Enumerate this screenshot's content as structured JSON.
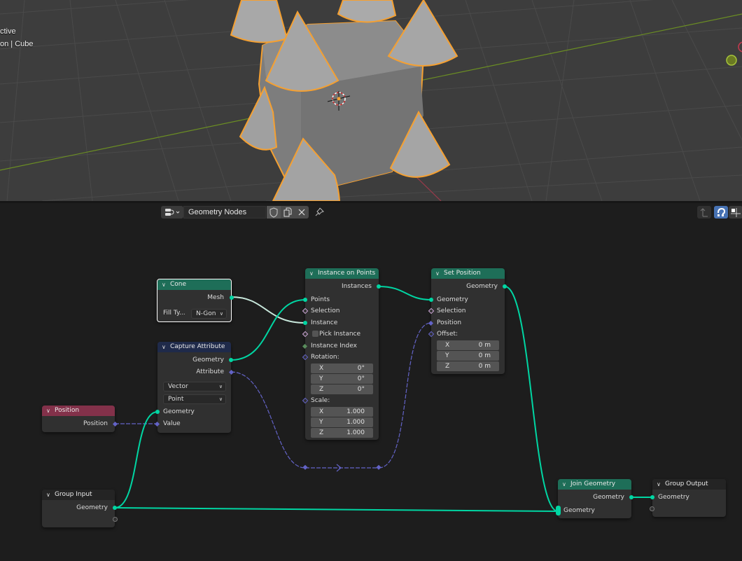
{
  "viewport": {
    "overlay_line1": "ctive",
    "overlay_line2": "on | Cube"
  },
  "header": {
    "editor_type_icon": "node-editor-icon",
    "node_tree_name": "Geometry Nodes",
    "fake_user_icon": "shield-icon",
    "duplicate_icon": "duplicate-icon",
    "unlink_icon": "close-icon",
    "pin_icon": "pin-icon",
    "parent_icon": "parent-arrow-icon",
    "snap_icon": "snap-magnet-icon",
    "grid_icon": "grid-icon"
  },
  "nodes": {
    "cone": {
      "title": "Cone",
      "outputs": [
        "Mesh"
      ],
      "fill_type_label": "Fill Ty...",
      "fill_type_value": "N-Gon"
    },
    "capture_attribute": {
      "title": "Capture Attribute",
      "outputs": [
        "Geometry",
        "Attribute"
      ],
      "data_type": "Vector",
      "domain": "Point",
      "inputs": [
        "Geometry",
        "Value"
      ]
    },
    "position": {
      "title": "Position",
      "outputs": [
        "Position"
      ]
    },
    "group_input": {
      "title": "Group Input",
      "outputs": [
        "Geometry"
      ]
    },
    "instance_on_points": {
      "title": "Instance on Points",
      "outputs": [
        "Instances"
      ],
      "inputs": [
        "Points",
        "Selection",
        "Instance",
        "Pick Instance",
        "Instance Index",
        "Rotation:",
        "Scale:"
      ],
      "rotation": [
        {
          "axis": "X",
          "value": "0°"
        },
        {
          "axis": "Y",
          "value": "0°"
        },
        {
          "axis": "Z",
          "value": "0°"
        }
      ],
      "scale": [
        {
          "axis": "X",
          "value": "1.000"
        },
        {
          "axis": "Y",
          "value": "1.000"
        },
        {
          "axis": "Z",
          "value": "1.000"
        }
      ],
      "pick_instance": false
    },
    "set_position": {
      "title": "Set Position",
      "outputs": [
        "Geometry"
      ],
      "inputs": [
        "Geometry",
        "Selection",
        "Position",
        "Offset:"
      ],
      "offset": [
        {
          "axis": "X",
          "value": "0 m"
        },
        {
          "axis": "Y",
          "value": "0 m"
        },
        {
          "axis": "Z",
          "value": "0 m"
        }
      ]
    },
    "join_geometry": {
      "title": "Join Geometry",
      "outputs": [
        "Geometry"
      ],
      "inputs": [
        "Geometry"
      ]
    },
    "group_output": {
      "title": "Group Output",
      "inputs": [
        "Geometry"
      ]
    }
  },
  "colors": {
    "geometry_socket": "#00d6a3",
    "vector_socket": "#6363c7",
    "geometry_header": "#1e6e58",
    "attribute_header": "#1f2a4a",
    "input_header": "#83314a",
    "selection_outline": "#f5a031"
  }
}
